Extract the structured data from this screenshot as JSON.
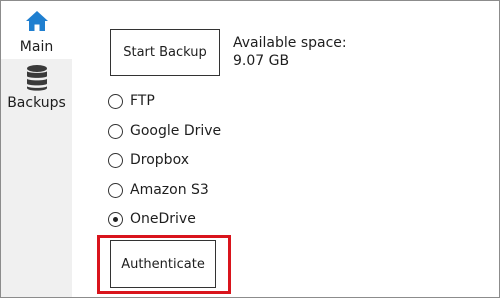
{
  "sidebar": {
    "items": [
      {
        "label": "Main",
        "icon": "home-icon",
        "selected": true
      },
      {
        "label": "Backups",
        "icon": "database-icon",
        "selected": false
      }
    ]
  },
  "main": {
    "start_backup_label": "Start Backup",
    "available_space_label": "Available space:",
    "available_space_value": "9.07 GB",
    "destinations": [
      {
        "label": "FTP",
        "checked": false
      },
      {
        "label": "Google Drive",
        "checked": false
      },
      {
        "label": "Dropbox",
        "checked": false
      },
      {
        "label": "Amazon S3",
        "checked": false
      },
      {
        "label": "OneDrive",
        "checked": true
      }
    ],
    "authenticate_label": "Authenticate"
  },
  "colors": {
    "accent": "#1f7fd0",
    "highlight": "#d9141c",
    "sidebar_bg": "#f0f0f0"
  }
}
